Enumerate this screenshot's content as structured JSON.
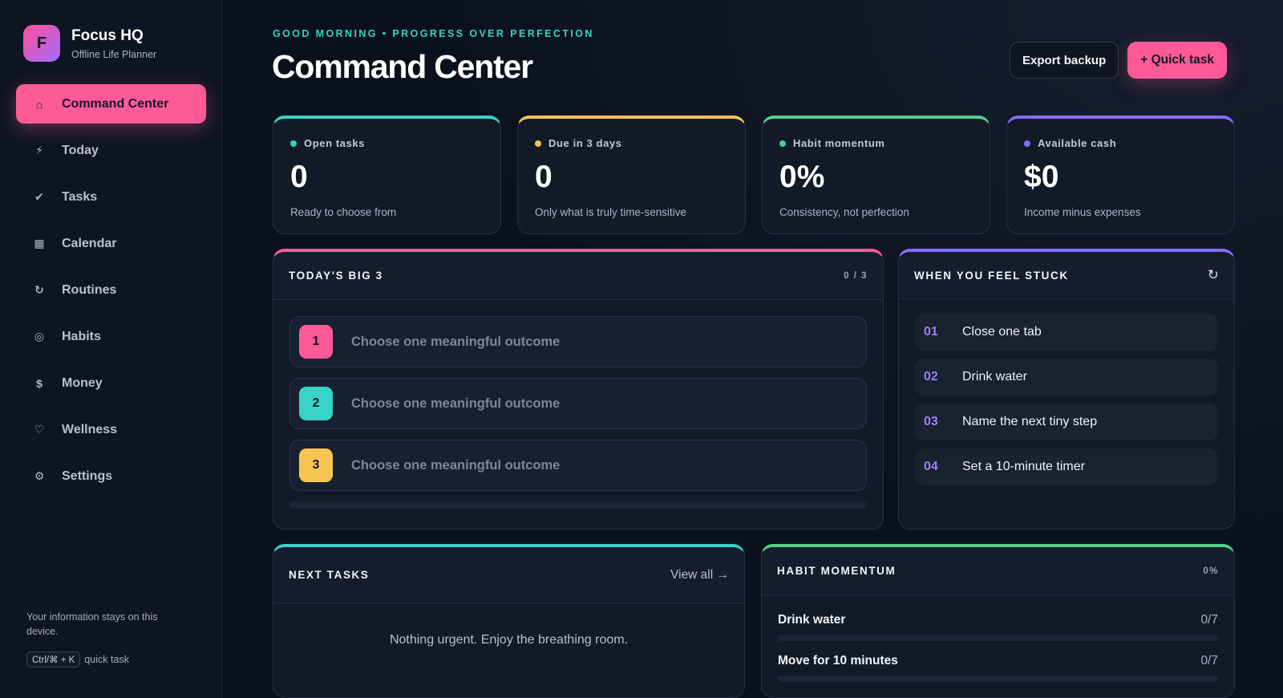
{
  "brand": {
    "logo_letter": "F",
    "name": "Focus HQ",
    "subtitle": "Offline Life Planner"
  },
  "nav": [
    {
      "label": "Command Center",
      "icon": "home-icon",
      "glyph": "⌂",
      "active": true
    },
    {
      "label": "Today",
      "icon": "lightning-icon",
      "glyph": "⚡"
    },
    {
      "label": "Tasks",
      "icon": "check-icon",
      "glyph": "✔"
    },
    {
      "label": "Calendar",
      "icon": "calendar-icon",
      "glyph": "▦"
    },
    {
      "label": "Routines",
      "icon": "refresh-icon",
      "glyph": "↻"
    },
    {
      "label": "Habits",
      "icon": "target-icon",
      "glyph": "◎"
    },
    {
      "label": "Money",
      "icon": "dollar-icon",
      "glyph": "$"
    },
    {
      "label": "Wellness",
      "icon": "heart-icon",
      "glyph": "♡"
    },
    {
      "label": "Settings",
      "icon": "gear-icon",
      "glyph": "⚙"
    }
  ],
  "sidebar_footer": {
    "note": "Your information stays on this device.",
    "shortcut_key": "Ctrl/⌘ + K",
    "shortcut_label": "quick task"
  },
  "header": {
    "eyebrow": "GOOD MORNING • PROGRESS OVER PERFECTION",
    "title": "Command Center",
    "export_label": "Export backup",
    "quick_task_label": "+ Quick task"
  },
  "stats": [
    {
      "label": "Open tasks",
      "value": "0",
      "sub": "Ready to choose from",
      "color": "#36d3c6"
    },
    {
      "label": "Due in 3 days",
      "value": "0",
      "sub": "Only what is truly time-sensitive",
      "color": "#f5c451"
    },
    {
      "label": "Habit momentum",
      "value": "0%",
      "sub": "Consistency, not perfection",
      "color": "#4fd18b"
    },
    {
      "label": "Available cash",
      "value": "$0",
      "sub": "Income minus expenses",
      "color": "#8a6cff"
    }
  ],
  "big3": {
    "title": "TODAY'S BIG 3",
    "count": "0 / 3",
    "items": [
      {
        "num": "1",
        "text": "Choose one meaningful outcome",
        "color": "#ff5a98"
      },
      {
        "num": "2",
        "text": "Choose one meaningful outcome",
        "color": "#36d3c6"
      },
      {
        "num": "3",
        "text": "Choose one meaningful outcome",
        "color": "#f5c451"
      }
    ]
  },
  "stuck": {
    "title": "WHEN YOU FEEL STUCK",
    "refresh_glyph": "↻",
    "items": [
      {
        "num": "01",
        "text": "Close one tab"
      },
      {
        "num": "02",
        "text": "Drink water"
      },
      {
        "num": "03",
        "text": "Name the next tiny step"
      },
      {
        "num": "04",
        "text": "Set a 10-minute timer"
      }
    ]
  },
  "next_tasks": {
    "title": "NEXT TASKS",
    "view_all": "View all →",
    "empty": "Nothing urgent. Enjoy the breathing room."
  },
  "habit_momentum": {
    "title": "HABIT MOMENTUM",
    "percent": "0%",
    "habits": [
      {
        "name": "Drink water",
        "count": "0/7",
        "progress": 0
      },
      {
        "name": "Move for 10 minutes",
        "count": "0/7",
        "progress": 0
      }
    ]
  }
}
